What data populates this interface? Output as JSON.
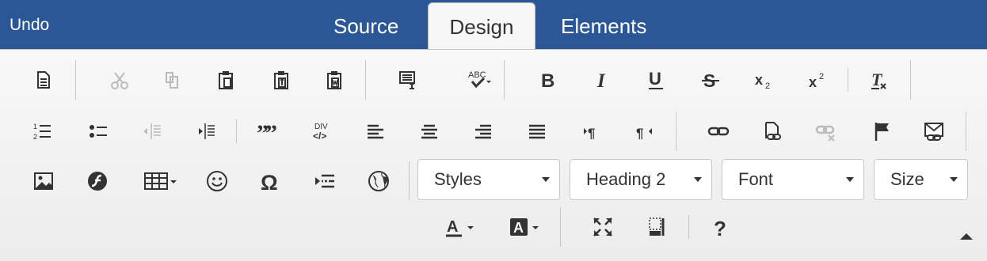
{
  "header": {
    "undo_label": "Undo",
    "tabs": [
      {
        "label": "Source",
        "active": false
      },
      {
        "label": "Design",
        "active": true
      },
      {
        "label": "Elements",
        "active": false
      }
    ],
    "color": "#2b5797"
  },
  "toolbar": {
    "format": {
      "styles": "Styles",
      "format": "Heading 2",
      "font": "Font",
      "size": "Size"
    },
    "icons": [
      "new-page-icon",
      "cut-icon",
      "copy-icon",
      "paste-icon",
      "paste-text-icon",
      "paste-word-icon",
      "templates-icon",
      "spellcheck-icon",
      "bold-icon",
      "italic-icon",
      "underline-icon",
      "strikethrough-icon",
      "subscript-icon",
      "superscript-icon",
      "remove-format-icon",
      "numbered-list-icon",
      "bulleted-list-icon",
      "decrease-indent-icon",
      "increase-indent-icon",
      "blockquote-icon",
      "div-container-icon",
      "align-left-icon",
      "align-center-icon",
      "align-right-icon",
      "justify-icon",
      "ltr-icon",
      "rtl-icon",
      "link-icon",
      "anchor-icon",
      "unlink-icon",
      "flag-icon",
      "email-link-icon",
      "image-icon",
      "flash-icon",
      "table-icon",
      "smiley-icon",
      "special-char-icon",
      "page-break-icon",
      "iframe-icon",
      "text-color-icon",
      "background-color-icon",
      "maximize-icon",
      "show-blocks-icon",
      "help-icon"
    ]
  }
}
